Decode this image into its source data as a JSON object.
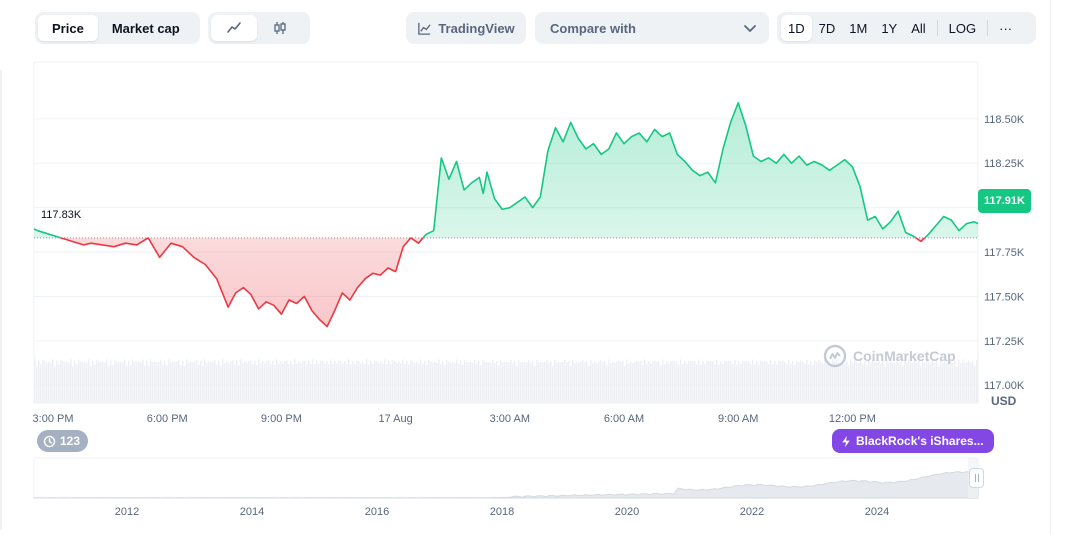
{
  "toolbar": {
    "type_tabs": [
      "Price",
      "Market cap"
    ],
    "active_type": "Price",
    "tradingview_label": "TradingView",
    "compare_label": "Compare with",
    "ranges": [
      "1D",
      "7D",
      "1M",
      "1Y",
      "All"
    ],
    "active_range": "1D",
    "log_label": "LOG",
    "more_label": "···"
  },
  "colors": {
    "up": "#16c784",
    "down": "#ea3943",
    "accent": "#8247e5"
  },
  "price_tag": "117.91K",
  "open_label": "117.83K",
  "currency_label": "USD",
  "watermark": "CoinMarketCap",
  "events_count": "123",
  "news_label": "BlackRock's iShares...",
  "chart_data": {
    "type": "line",
    "unit": "USD",
    "open_price": 117830,
    "last_price": 117910,
    "ylim": [
      116900,
      118820
    ],
    "y_ticks": [
      {
        "value": 117000,
        "label": "117.00K"
      },
      {
        "value": 117250,
        "label": "117.25K"
      },
      {
        "value": 117500,
        "label": "117.50K"
      },
      {
        "value": 117750,
        "label": "117.75K"
      },
      {
        "value": 118000,
        "label": "118.00K"
      },
      {
        "value": 118250,
        "label": "118.25K"
      },
      {
        "value": 118500,
        "label": "118.50K"
      }
    ],
    "x_ticks": [
      {
        "hour": 15,
        "label": "3:00 PM"
      },
      {
        "hour": 18,
        "label": "6:00 PM"
      },
      {
        "hour": 21,
        "label": "9:00 PM"
      },
      {
        "hour": 24,
        "label": "17 Aug"
      },
      {
        "hour": 27,
        "label": "3:00 AM"
      },
      {
        "hour": 30,
        "label": "6:00 AM"
      },
      {
        "hour": 33,
        "label": "9:00 AM"
      },
      {
        "hour": 36,
        "label": "12:00 PM"
      }
    ],
    "xlim": [
      14.5,
      39.3
    ],
    "grid": true,
    "series": [
      {
        "x": [
          14.5,
          14.6,
          15.8,
          16.0,
          16.3,
          16.6,
          16.9,
          17.2,
          17.5,
          17.8,
          18.1,
          18.4,
          18.7,
          19.0,
          19.3,
          19.6,
          19.8,
          20.0,
          20.2,
          20.4,
          20.6,
          20.8,
          21.0,
          21.2,
          21.4,
          21.6,
          21.8,
          22.0,
          22.2,
          22.4,
          22.6,
          22.8,
          23.0,
          23.2,
          23.4,
          23.6,
          23.8,
          24.0,
          24.2,
          24.4,
          24.6,
          24.8,
          25.0,
          25.2,
          25.4,
          25.6,
          25.8,
          26.0,
          26.2,
          26.3,
          26.4,
          26.6,
          26.8,
          27.0,
          27.2,
          27.4,
          27.6,
          27.8,
          28.0,
          28.2,
          28.4,
          28.6,
          28.8,
          29.0,
          29.2,
          29.4,
          29.6,
          29.8,
          30.0,
          30.2,
          30.4,
          30.6,
          30.8,
          31.0,
          31.2,
          31.4,
          31.6,
          31.8,
          32.0,
          32.2,
          32.4,
          32.6,
          32.8,
          33.0,
          33.2,
          33.4,
          33.6,
          33.8,
          34.0,
          34.2,
          34.4,
          34.6,
          34.8,
          35.0,
          35.2,
          35.4,
          35.6,
          35.8,
          36.0,
          36.2,
          36.4,
          36.6,
          36.8,
          37.0,
          37.2,
          37.4,
          37.6,
          37.8,
          38.0,
          38.2,
          38.4,
          38.6,
          38.8,
          39.0,
          39.2,
          39.3
        ],
        "y": [
          117880,
          117870,
          117790,
          117800,
          117790,
          117780,
          117800,
          117790,
          117830,
          117720,
          117800,
          117780,
          117720,
          117680,
          117600,
          117440,
          117520,
          117550,
          117510,
          117430,
          117470,
          117450,
          117400,
          117480,
          117460,
          117500,
          117420,
          117370,
          117330,
          117420,
          117520,
          117480,
          117550,
          117600,
          117630,
          117620,
          117660,
          117640,
          117780,
          117830,
          117800,
          117850,
          117870,
          118280,
          118160,
          118260,
          118100,
          118140,
          118170,
          118080,
          118200,
          118050,
          117990,
          118000,
          118030,
          118060,
          118000,
          118060,
          118320,
          118450,
          118370,
          118480,
          118390,
          118330,
          118360,
          118300,
          118330,
          118420,
          118360,
          118400,
          118420,
          118370,
          118440,
          118400,
          118420,
          118300,
          118260,
          118210,
          118180,
          118200,
          118140,
          118330,
          118480,
          118590,
          118460,
          118290,
          118260,
          118280,
          118250,
          118300,
          118250,
          118290,
          118240,
          118260,
          118240,
          118210,
          118240,
          118270,
          118230,
          118120,
          117930,
          117950,
          117880,
          117920,
          117980,
          117860,
          117840,
          117810,
          117850,
          117900,
          117950,
          117930,
          117870,
          117910,
          117920,
          117910
        ]
      }
    ],
    "navigator": {
      "x_ticks": [
        "2012",
        "2014",
        "2016",
        "2018",
        "2020",
        "2022",
        "2024"
      ]
    }
  }
}
